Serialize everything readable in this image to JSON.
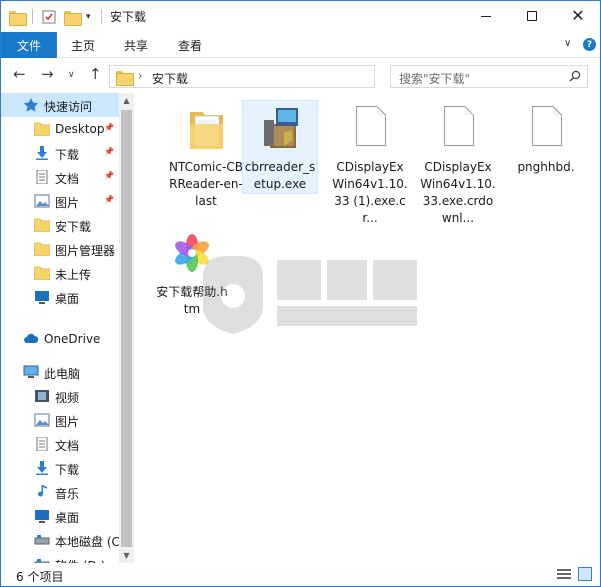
{
  "window": {
    "title": "安下载",
    "controls": {
      "minimize": "minimize",
      "maximize": "maximize",
      "close": "✕"
    }
  },
  "ribbon": {
    "tabs": [
      {
        "label": "文件",
        "active": true
      },
      {
        "label": "主页",
        "active": false
      },
      {
        "label": "共享",
        "active": false
      },
      {
        "label": "查看",
        "active": false
      }
    ],
    "help": "?"
  },
  "address_bar": {
    "breadcrumb": "安下载",
    "refresh": "↻"
  },
  "search": {
    "placeholder": "搜索\"安下载\""
  },
  "navigation": {
    "items": [
      {
        "label": "快速访问",
        "icon": "star-icon",
        "pinned": false,
        "selected": true
      },
      {
        "label": "Desktop",
        "icon": "folder-icon",
        "pinned": true
      },
      {
        "label": "下载",
        "icon": "download-icon",
        "pinned": true
      },
      {
        "label": "文档",
        "icon": "document-icon",
        "pinned": true
      },
      {
        "label": "图片",
        "icon": "picture-icon",
        "pinned": true
      },
      {
        "label": "安下载",
        "icon": "folder-icon",
        "pinned": false
      },
      {
        "label": "图片管理器",
        "icon": "folder-icon",
        "pinned": false
      },
      {
        "label": "未上传",
        "icon": "folder-icon",
        "pinned": false
      },
      {
        "label": "桌面",
        "icon": "desktop-icon",
        "pinned": false
      },
      {
        "label": "OneDrive",
        "icon": "cloud-icon",
        "pinned": false
      },
      {
        "label": "此电脑",
        "icon": "computer-icon",
        "pinned": false
      },
      {
        "label": "视频",
        "icon": "video-icon",
        "pinned": false
      },
      {
        "label": "图片",
        "icon": "picture-icon",
        "pinned": false
      },
      {
        "label": "文档",
        "icon": "document-icon",
        "pinned": false
      },
      {
        "label": "下载",
        "icon": "download-icon",
        "pinned": false
      },
      {
        "label": "音乐",
        "icon": "music-icon",
        "pinned": false
      },
      {
        "label": "桌面",
        "icon": "desktop-icon",
        "pinned": false
      },
      {
        "label": "本地磁盘 (C",
        "icon": "drive-icon",
        "pinned": false
      },
      {
        "label": "软件 (D:)",
        "icon": "drive-icon",
        "pinned": false
      }
    ]
  },
  "files": [
    {
      "name": "NTComic-CBRReader-en-last",
      "icon": "folder-icon",
      "selected": false
    },
    {
      "name": "cbrreader_setup.exe",
      "icon": "installer-icon",
      "selected": true
    },
    {
      "name": "CDisplayExWin64v1.10.33 (1).exe.cr...",
      "icon": "blank-document-icon",
      "selected": false
    },
    {
      "name": "CDisplayExWin64v1.10.33.exe.crdownl...",
      "icon": "blank-document-icon",
      "selected": false
    },
    {
      "name": "pnghhbd.",
      "icon": "blank-document-icon",
      "selected": false
    },
    {
      "name": "安下载帮助.htm",
      "icon": "color-wheel-icon",
      "selected": false
    }
  ],
  "status": {
    "item_count": "6 个项目"
  },
  "colors": {
    "accent": "#1979ca",
    "selection": "#cce8ff",
    "window_border": "#2b7bd6",
    "folder": "#f6d36b"
  }
}
